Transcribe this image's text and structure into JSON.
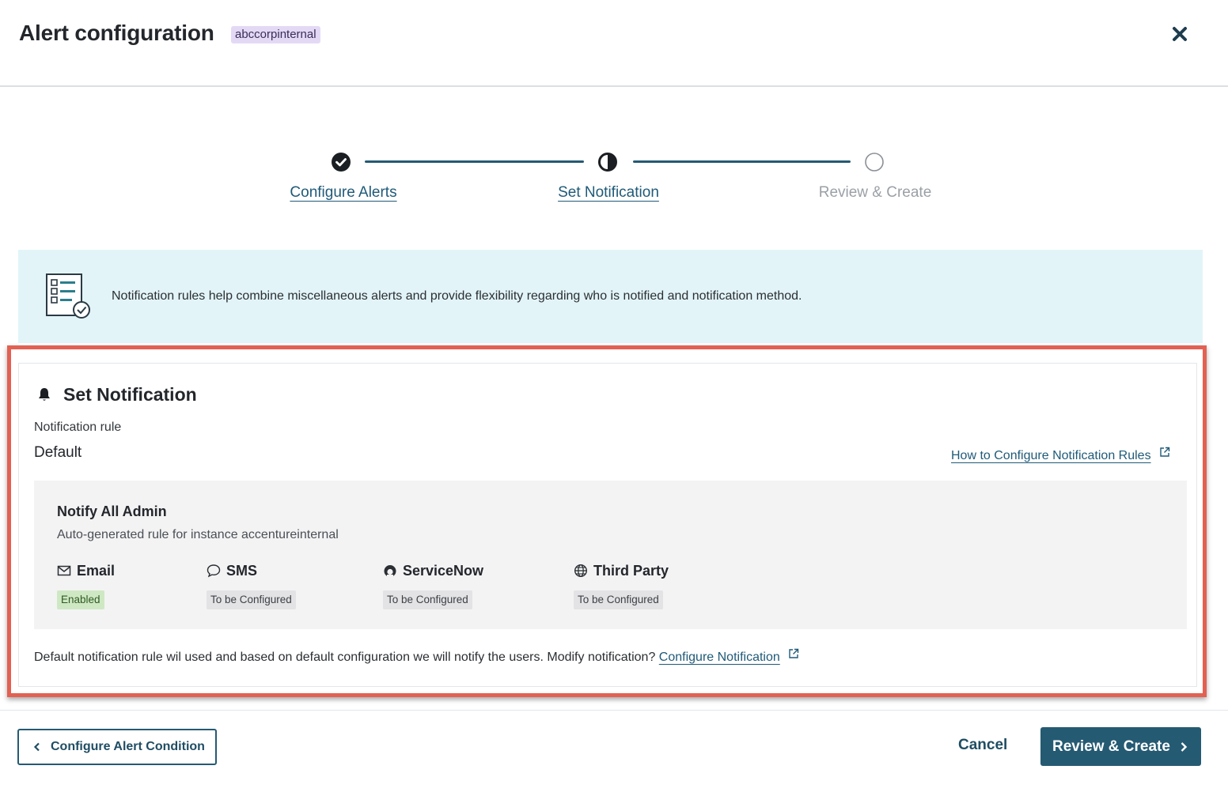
{
  "header": {
    "title": "Alert configuration",
    "instance_badge": "abccorpinternal",
    "close_icon": "close-icon"
  },
  "stepper": {
    "steps": [
      {
        "label": "Configure Alerts",
        "state": "complete",
        "icon": "check-circle-icon"
      },
      {
        "label": "Set Notification",
        "state": "in-progress",
        "icon": "half-circle-icon"
      },
      {
        "label": "Review & Create",
        "state": "pending",
        "icon": "empty-circle-icon"
      }
    ]
  },
  "info_banner": {
    "icon": "checklist-icon",
    "text": "Notification rules help combine miscellaneous alerts and provide flexibility regarding who is notified and notification method."
  },
  "set_notification": {
    "title": "Set Notification",
    "title_icon": "bell-icon",
    "rule_label": "Notification rule",
    "rule_value": "Default",
    "help_link": "How to Configure Notification Rules",
    "rule": {
      "name": "Notify All Admin",
      "description": "Auto-generated rule for instance accentureinternal",
      "channels": [
        {
          "label": "Email",
          "icon": "mail-icon",
          "status": "Enabled"
        },
        {
          "label": "SMS",
          "icon": "chat-bubble-icon",
          "status": "To be Configured"
        },
        {
          "label": "ServiceNow",
          "icon": "servicenow-icon",
          "status": "To be Configured"
        },
        {
          "label": "Third Party",
          "icon": "globe-icon",
          "status": "To be Configured"
        }
      ]
    },
    "note_text": "Default notification rule wil used and based on default configuration we will notify the users. Modify notification?",
    "note_link": "Configure Notification"
  },
  "colors": {
    "primary": "#255a73",
    "highlight_border": "#e26152",
    "banner_bg": "#e2f4f8",
    "enabled_badge": "#cfe8c4",
    "instance_badge": "#e4d9f5"
  },
  "footer": {
    "back_label": "Configure Alert Condition",
    "cancel_label": "Cancel",
    "primary_label": "Review & Create"
  }
}
